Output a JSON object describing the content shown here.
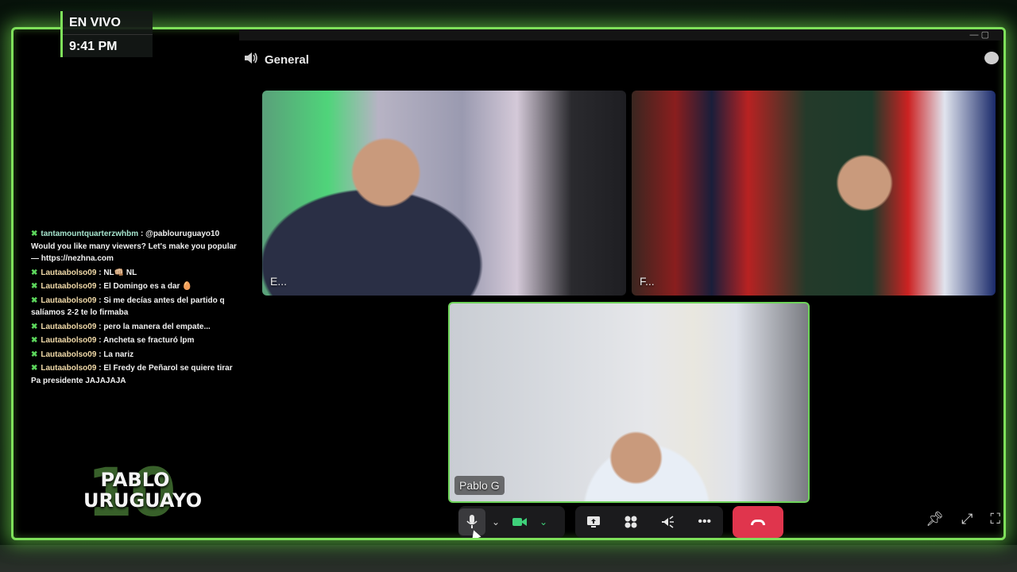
{
  "live_badge": {
    "label": "EN VIVO",
    "time": "9:41 PM"
  },
  "channel": {
    "icon": "speaker-icon",
    "name": "General"
  },
  "participants": [
    {
      "initial": "E..."
    },
    {
      "initial": "F..."
    },
    {
      "initial": "Pablo G"
    }
  ],
  "chat": [
    {
      "user": "tantamountquarterzwhbm",
      "text": "@pablouruguayo10 Would you like many viewers? Let's make you popular — https://nezhna.com"
    },
    {
      "user": "Lautaabolso09",
      "text": "NL👊🏼 NL"
    },
    {
      "user": "Lautaabolso09",
      "text": "El Domingo es a dar 🥚"
    },
    {
      "user": "Lautaabolso09",
      "text": "Si me decías antes del partido q salíamos 2-2 te lo firmaba"
    },
    {
      "user": "Lautaabolso09",
      "text": "pero la manera del empate..."
    },
    {
      "user": "Lautaabolso09",
      "text": "Ancheta se fracturó lpm"
    },
    {
      "user": "Lautaabolso09",
      "text": "La nariz"
    },
    {
      "user": "Lautaabolso09",
      "text": "El Fredy de Peñarol se quiere tirar Pa presidente JAJAJAJA"
    }
  ],
  "logo": {
    "number": "10",
    "line1": "PABLO",
    "line2": "URUGUAYO"
  },
  "controls": {
    "mic": "microphone-icon",
    "camera": "camera-icon",
    "share": "screen-share-icon",
    "activities": "activities-icon",
    "soundboard": "soundboard-icon",
    "more": "more-icon",
    "hangup": "hangup-icon",
    "pin": "pin-icon",
    "popout": "popout-icon",
    "fullscreen": "fullscreen-icon"
  },
  "colors": {
    "accent_green": "#7ee05a",
    "hangup_red": "#e0354d",
    "speaking_border": "#6ed35a"
  }
}
